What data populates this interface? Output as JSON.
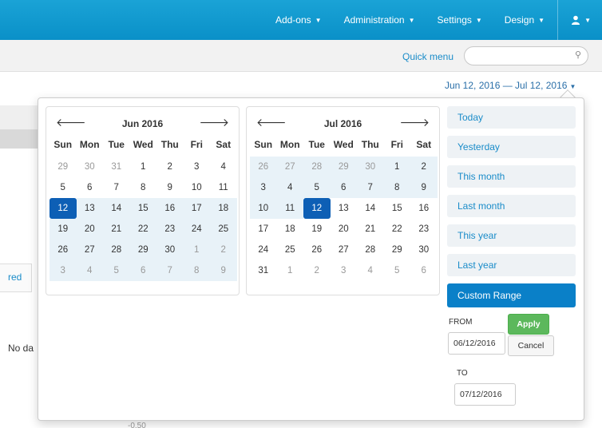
{
  "topnav": {
    "items": [
      {
        "label": "Add-ons",
        "caret": "▼"
      },
      {
        "label": "Administration",
        "caret": "▼"
      },
      {
        "label": "Settings",
        "caret": "▼"
      },
      {
        "label": "Design",
        "caret": "▼"
      }
    ],
    "user_icon": "user-icon",
    "user_caret": "▼"
  },
  "subbar": {
    "quick_menu": "Quick menu",
    "search_placeholder": "",
    "search_icon": "⚲"
  },
  "daterange_label": "Jun 12, 2016 — Jul 12, 2016",
  "background": {
    "ed_text": "red",
    "nodata_text": "No da",
    "axis_text": "-0.50"
  },
  "calendars": [
    {
      "month": "Jun 2016",
      "prev": "🡐",
      "next": "🡒",
      "dow": [
        "Sun",
        "Mon",
        "Tue",
        "Wed",
        "Thu",
        "Fri",
        "Sat"
      ],
      "weeks": [
        [
          {
            "d": "29",
            "s": "off"
          },
          {
            "d": "30",
            "s": "off"
          },
          {
            "d": "31",
            "s": "off"
          },
          {
            "d": "1",
            "s": ""
          },
          {
            "d": "2",
            "s": ""
          },
          {
            "d": "3",
            "s": ""
          },
          {
            "d": "4",
            "s": ""
          }
        ],
        [
          {
            "d": "5",
            "s": ""
          },
          {
            "d": "6",
            "s": ""
          },
          {
            "d": "7",
            "s": ""
          },
          {
            "d": "8",
            "s": ""
          },
          {
            "d": "9",
            "s": ""
          },
          {
            "d": "10",
            "s": ""
          },
          {
            "d": "11",
            "s": ""
          }
        ],
        [
          {
            "d": "12",
            "s": "active"
          },
          {
            "d": "13",
            "s": "inrange"
          },
          {
            "d": "14",
            "s": "inrange"
          },
          {
            "d": "15",
            "s": "inrange"
          },
          {
            "d": "16",
            "s": "inrange"
          },
          {
            "d": "17",
            "s": "inrange"
          },
          {
            "d": "18",
            "s": "inrange"
          }
        ],
        [
          {
            "d": "19",
            "s": "inrange"
          },
          {
            "d": "20",
            "s": "inrange"
          },
          {
            "d": "21",
            "s": "inrange"
          },
          {
            "d": "22",
            "s": "inrange"
          },
          {
            "d": "23",
            "s": "inrange"
          },
          {
            "d": "24",
            "s": "inrange"
          },
          {
            "d": "25",
            "s": "inrange"
          }
        ],
        [
          {
            "d": "26",
            "s": "inrange"
          },
          {
            "d": "27",
            "s": "inrange"
          },
          {
            "d": "28",
            "s": "inrange"
          },
          {
            "d": "29",
            "s": "inrange"
          },
          {
            "d": "30",
            "s": "inrange"
          },
          {
            "d": "1",
            "s": "off inrange"
          },
          {
            "d": "2",
            "s": "off inrange"
          }
        ],
        [
          {
            "d": "3",
            "s": "off inrange"
          },
          {
            "d": "4",
            "s": "off inrange"
          },
          {
            "d": "5",
            "s": "off inrange"
          },
          {
            "d": "6",
            "s": "off inrange"
          },
          {
            "d": "7",
            "s": "off inrange"
          },
          {
            "d": "8",
            "s": "off inrange"
          },
          {
            "d": "9",
            "s": "off inrange"
          }
        ]
      ]
    },
    {
      "month": "Jul 2016",
      "prev": "🡐",
      "next": "🡒",
      "dow": [
        "Sun",
        "Mon",
        "Tue",
        "Wed",
        "Thu",
        "Fri",
        "Sat"
      ],
      "weeks": [
        [
          {
            "d": "26",
            "s": "off inrange"
          },
          {
            "d": "27",
            "s": "off inrange"
          },
          {
            "d": "28",
            "s": "off inrange"
          },
          {
            "d": "29",
            "s": "off inrange"
          },
          {
            "d": "30",
            "s": "off inrange"
          },
          {
            "d": "1",
            "s": "inrange"
          },
          {
            "d": "2",
            "s": "inrange"
          }
        ],
        [
          {
            "d": "3",
            "s": "inrange"
          },
          {
            "d": "4",
            "s": "inrange"
          },
          {
            "d": "5",
            "s": "inrange"
          },
          {
            "d": "6",
            "s": "inrange"
          },
          {
            "d": "7",
            "s": "inrange"
          },
          {
            "d": "8",
            "s": "inrange"
          },
          {
            "d": "9",
            "s": "inrange"
          }
        ],
        [
          {
            "d": "10",
            "s": "inrange"
          },
          {
            "d": "11",
            "s": "inrange"
          },
          {
            "d": "12",
            "s": "active"
          },
          {
            "d": "13",
            "s": ""
          },
          {
            "d": "14",
            "s": ""
          },
          {
            "d": "15",
            "s": ""
          },
          {
            "d": "16",
            "s": ""
          }
        ],
        [
          {
            "d": "17",
            "s": ""
          },
          {
            "d": "18",
            "s": ""
          },
          {
            "d": "19",
            "s": ""
          },
          {
            "d": "20",
            "s": ""
          },
          {
            "d": "21",
            "s": ""
          },
          {
            "d": "22",
            "s": ""
          },
          {
            "d": "23",
            "s": ""
          }
        ],
        [
          {
            "d": "24",
            "s": ""
          },
          {
            "d": "25",
            "s": ""
          },
          {
            "d": "26",
            "s": ""
          },
          {
            "d": "27",
            "s": ""
          },
          {
            "d": "28",
            "s": ""
          },
          {
            "d": "29",
            "s": ""
          },
          {
            "d": "30",
            "s": ""
          }
        ],
        [
          {
            "d": "31",
            "s": ""
          },
          {
            "d": "1",
            "s": "off"
          },
          {
            "d": "2",
            "s": "off"
          },
          {
            "d": "3",
            "s": "off"
          },
          {
            "d": "4",
            "s": "off"
          },
          {
            "d": "5",
            "s": "off"
          },
          {
            "d": "6",
            "s": "off"
          }
        ]
      ]
    }
  ],
  "ranges": [
    {
      "label": "Today",
      "active": false
    },
    {
      "label": "Yesterday",
      "active": false
    },
    {
      "label": "This month",
      "active": false
    },
    {
      "label": "Last month",
      "active": false
    },
    {
      "label": "This year",
      "active": false
    },
    {
      "label": "Last year",
      "active": false
    },
    {
      "label": "Custom Range",
      "active": true
    }
  ],
  "custom": {
    "from_label": "FROM",
    "from_value": "06/12/2016",
    "to_label": "TO",
    "to_value": "07/12/2016",
    "apply_label": "Apply",
    "cancel_label": "Cancel"
  },
  "colors": {
    "header": "#0a90c8",
    "accent": "#1a8cc9",
    "active_day": "#0d5fb5",
    "in_range": "#e8f2f8",
    "apply": "#5cb85c",
    "custom_range_active": "#0a80c8"
  }
}
